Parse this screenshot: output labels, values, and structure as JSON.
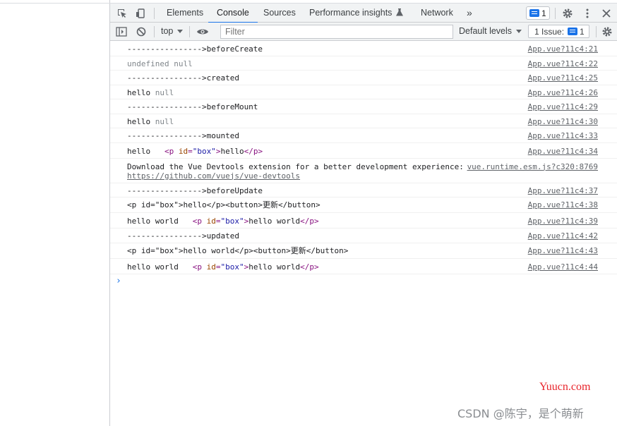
{
  "tabs": {
    "elements": "Elements",
    "console": "Console",
    "sources": "Sources",
    "performance": "Performance insights",
    "network": "Network",
    "more": "»",
    "message_count": "1"
  },
  "toolbar": {
    "context": "top",
    "filter_placeholder": "Filter",
    "levels": "Default levels",
    "issues_label": "1 Issue:",
    "issues_count": "1"
  },
  "console": {
    "rows": [
      {
        "text": "---------------->beforeCreate",
        "src": "App.vue?11c4:21"
      },
      {
        "text": "undefined null",
        "src": "App.vue?11c4:22"
      },
      {
        "text": "---------------->created",
        "src": "App.vue?11c4:25"
      },
      {
        "text_a": "hello",
        "text_b": "null",
        "src": "App.vue?11c4:26"
      },
      {
        "text": "---------------->beforeMount",
        "src": "App.vue?11c4:29"
      },
      {
        "text_a": "hello",
        "text_b": "null",
        "src": "App.vue?11c4:30"
      },
      {
        "text": "---------------->mounted",
        "src": "App.vue?11c4:33"
      },
      {
        "text_a": "hello",
        "p_open": "<p",
        "attr": "id",
        "val": "\"box\"",
        "inner": "hello",
        "p_close": "</p>",
        "src": "App.vue?11c4:34"
      },
      {
        "line1": "Download the Vue Devtools extension for a better development experience:",
        "link": "https://github.com/vuejs/vue-devtools",
        "src": "vue.runtime.esm.js?c320:8769"
      },
      {
        "text": "---------------->beforeUpdate",
        "src": "App.vue?11c4:37"
      },
      {
        "text": "<p id=\"box\">hello</p><button>更新</button>",
        "src": "App.vue?11c4:38"
      },
      {
        "text_a": "hello world",
        "p_open": "<p",
        "attr": "id",
        "val": "\"box\"",
        "inner": "hello world",
        "p_close": "</p>",
        "src": "App.vue?11c4:39"
      },
      {
        "text": "---------------->updated",
        "src": "App.vue?11c4:42"
      },
      {
        "text": "<p id=\"box\">hello world</p><button>更新</button>",
        "src": "App.vue?11c4:43"
      },
      {
        "text_a": "hello world",
        "p_open": "<p",
        "attr": "id",
        "val": "\"box\"",
        "inner": "hello world",
        "p_close": "</p>",
        "src": "App.vue?11c4:44"
      }
    ],
    "prompt": "›"
  },
  "watermark": {
    "site": "Yuucn.com",
    "author": "CSDN @陈宇，是个萌新"
  },
  "colors": {
    "accent": "#1a73e8",
    "watermark_red": "#e8242b"
  }
}
